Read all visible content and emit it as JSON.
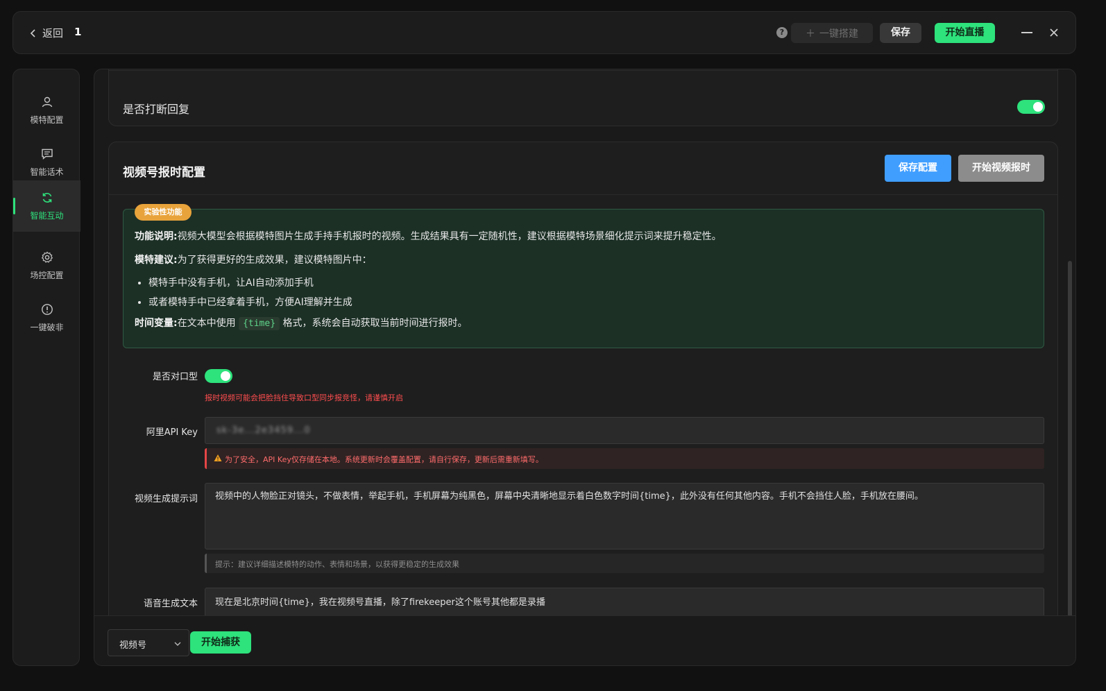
{
  "titlebar": {
    "back_label": "返回",
    "title": "1",
    "help_icon": "?",
    "onekey_label": "一键搭建",
    "save_label": "保存",
    "start_live_label": "开始直播"
  },
  "sidebar": {
    "items": [
      {
        "label": "模特配置",
        "icon": "user-icon"
      },
      {
        "label": "智能话术",
        "icon": "message-icon"
      },
      {
        "label": "智能互动",
        "icon": "refresh-icon",
        "active": true
      },
      {
        "label": "场控配置",
        "icon": "gear-icon"
      },
      {
        "label": "一键破非",
        "icon": "alert-circle-icon"
      }
    ]
  },
  "interrupt_card": {
    "label": "是否打断回复",
    "enabled": true
  },
  "video_card": {
    "title": "视频号报时配置",
    "save_config_label": "保存配置",
    "start_video_label": "开始视频报时",
    "notice": {
      "badge": "实验性功能",
      "func_title": "功能说明:",
      "func_text": "视频大模型会根据模特图片生成手持手机报时的视频。生成结果具有一定随机性，建议根据模特场景细化提示词来提升稳定性。",
      "model_title": "模特建议:",
      "model_text": "为了获得更好的生成效果，建议模特图片中：",
      "bullets": [
        "模特手中没有手机，让AI自动添加手机",
        "或者模特手中已经拿着手机，方便AI理解并生成"
      ],
      "time_title": "时间变量:",
      "time_text_before": "在文本中使用",
      "time_code": "{time}",
      "time_text_after": "格式，系统会自动获取当前时间进行报时。"
    },
    "lip_sync": {
      "label": "是否对口型",
      "enabled": true,
      "warning": "报时视频可能会把脸挡住导致口型同步报竞怪，请谨慎开启"
    },
    "api_key": {
      "label": "阿里API Key",
      "value": "sk-3e...2e3459...0",
      "alert": "为了安全，API Key仅存储在本地。系统更新时会覆盖配置，请自行保存，更新后需重新填写。"
    },
    "video_prompt": {
      "label": "视频生成提示词",
      "value": "视频中的人物脸正对镜头，不做表情，举起手机，手机屏幕为纯黑色，屏幕中央清晰地显示着白色数字时间{time}，此外没有任何其他内容。手机不会挡住人脸，手机放在腰间。",
      "hint": "提示：建议详细描述模特的动作、表情和场景，以获得更稳定的生成效果"
    },
    "voice_text": {
      "label": "语音生成文本",
      "value": "现在是北京时间{time}，我在视频号直播，除了firekeeper这个账号其他都是录播"
    }
  },
  "bottom": {
    "platform_select": "视频号",
    "capture_label": "开始捕获"
  },
  "colors": {
    "accent_green": "#2ee27c",
    "primary_blue": "#409eff",
    "warning_orange": "#e8a33b",
    "danger_red": "#ff4d4f"
  }
}
